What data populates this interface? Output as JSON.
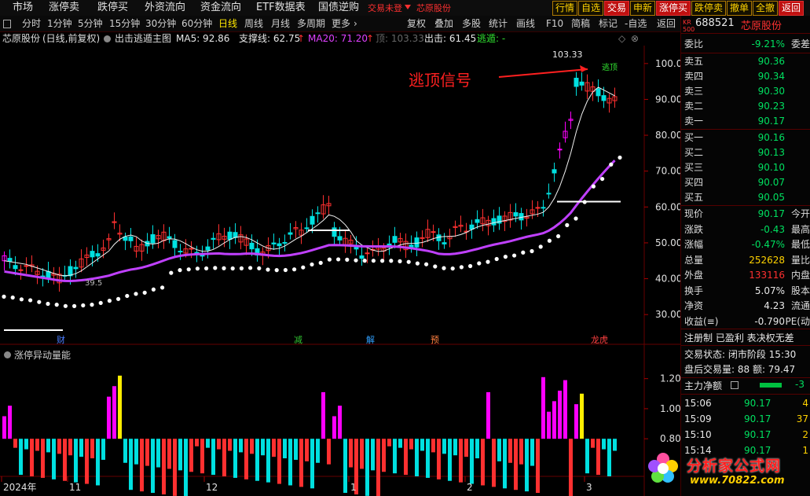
{
  "menubar": {
    "items": [
      "市场",
      "涨停卖",
      "跌停买",
      "外资流向",
      "资金流向",
      "ETF数据表",
      "国债逆购"
    ],
    "marquee": "交易未登",
    "marquee_stock": "芯原股份",
    "right_buttons": [
      "行情",
      "自选",
      "交易",
      "申新",
      "涨停买",
      "跌停卖",
      "撤单",
      "全撤",
      "返回"
    ]
  },
  "tabs": {
    "periods": [
      "分时",
      "1分钟",
      "5分钟",
      "15分钟",
      "30分钟",
      "60分钟",
      "日线",
      "周线",
      "月线",
      "多周期",
      "更多"
    ],
    "selected": "日线",
    "tools": [
      "复权",
      "叠加",
      "多股",
      "统计",
      "画线",
      "F10",
      "简稿",
      "标记",
      "-自选",
      "返回"
    ]
  },
  "indicator_bar": {
    "stock": "芯原股份",
    "mode": "(日线,前复权)",
    "formula": "出击逃遁主图",
    "ma5": "MA5: 92.86",
    "support": "支撑线: 62.75",
    "ma20": "MA20: 71.20",
    "up_label": "顶: 103.33",
    "strike": "出击: 61.45",
    "escape": "逃遁: -"
  },
  "main_chart": {
    "annotation": "逃顶信号",
    "high_label": "103.33",
    "low_label": "39.5",
    "top_signal_label": "逃顶",
    "y_ticks": [
      "100.0",
      "90.00",
      "80.00",
      "70.00",
      "60.00",
      "50.00",
      "40.00",
      "30.00"
    ],
    "event_markers": [
      {
        "label": "财",
        "color": "#4a7dff"
      },
      {
        "label": "减",
        "color": "#30c030"
      },
      {
        "label": "解",
        "color": "#30a0ff"
      },
      {
        "label": "预",
        "color": "#ff8040"
      },
      {
        "label": "龙虎",
        "color": "#ff4040"
      }
    ]
  },
  "sub_chart": {
    "title": "涨停异动量能",
    "y_ticks": [
      "1.20",
      "1.00",
      "0.80"
    ],
    "x_labels": [
      "2024年",
      "11",
      "12",
      "1",
      "2",
      "3"
    ]
  },
  "quote_panel": {
    "board": "KR\n500",
    "code": "688521",
    "name": "芯原股份",
    "weibi_label": "委比",
    "weibi_value": "-9.21%",
    "weicha_label": "委差",
    "asks": [
      {
        "label": "卖五",
        "price": "90.36"
      },
      {
        "label": "卖四",
        "price": "90.34"
      },
      {
        "label": "卖三",
        "price": "90.30"
      },
      {
        "label": "卖二",
        "price": "90.23"
      },
      {
        "label": "卖一",
        "price": "90.17"
      }
    ],
    "bids": [
      {
        "label": "买一",
        "price": "90.16"
      },
      {
        "label": "买二",
        "price": "90.13"
      },
      {
        "label": "买三",
        "price": "90.10"
      },
      {
        "label": "买四",
        "price": "90.07"
      },
      {
        "label": "买五",
        "price": "90.05"
      }
    ],
    "stats": [
      {
        "label": "现价",
        "value": "90.17",
        "extra": "今开",
        "cls": "grn"
      },
      {
        "label": "涨跌",
        "value": "-0.43",
        "extra": "最高",
        "cls": "grn"
      },
      {
        "label": "涨幅",
        "value": "-0.47%",
        "extra": "最低",
        "cls": "grn"
      },
      {
        "label": "总量",
        "value": "252628",
        "extra": "量比",
        "cls": "ylw"
      },
      {
        "label": "外盘",
        "value": "133116",
        "extra": "内盘",
        "cls": "red"
      },
      {
        "label": "换手",
        "value": "5.07%",
        "extra": "股本",
        "cls": "wht"
      },
      {
        "label": "净资",
        "value": "4.23",
        "extra": "流通",
        "cls": "wht"
      },
      {
        "label": "收益(≡)",
        "value": "-0.790",
        "extra": "PE(动",
        "cls": "wht"
      }
    ],
    "info_line": "注册制  已盈利  表决权无差",
    "trade_status": "交易状态: 闭市阶段 15:30",
    "after_hours": "盘后交易量: 88  额: 79.47",
    "net_flow_label": "主力净额",
    "ticks": [
      {
        "time": "15:06",
        "price": "90.17",
        "vol": "4"
      },
      {
        "time": "15:09",
        "price": "90.17",
        "vol": "37"
      },
      {
        "time": "15:10",
        "price": "90.17",
        "vol": "2"
      },
      {
        "time": "15:14",
        "price": "90.17",
        "vol": "1"
      }
    ]
  },
  "watermark": {
    "title": "分析家公式网",
    "url": "www.70822.com"
  },
  "colors": {
    "up": "#ff3030",
    "down": "#00e0e0",
    "magenta": "#ff00ff",
    "ma20": "#c040ff",
    "bg": "#000000"
  }
}
